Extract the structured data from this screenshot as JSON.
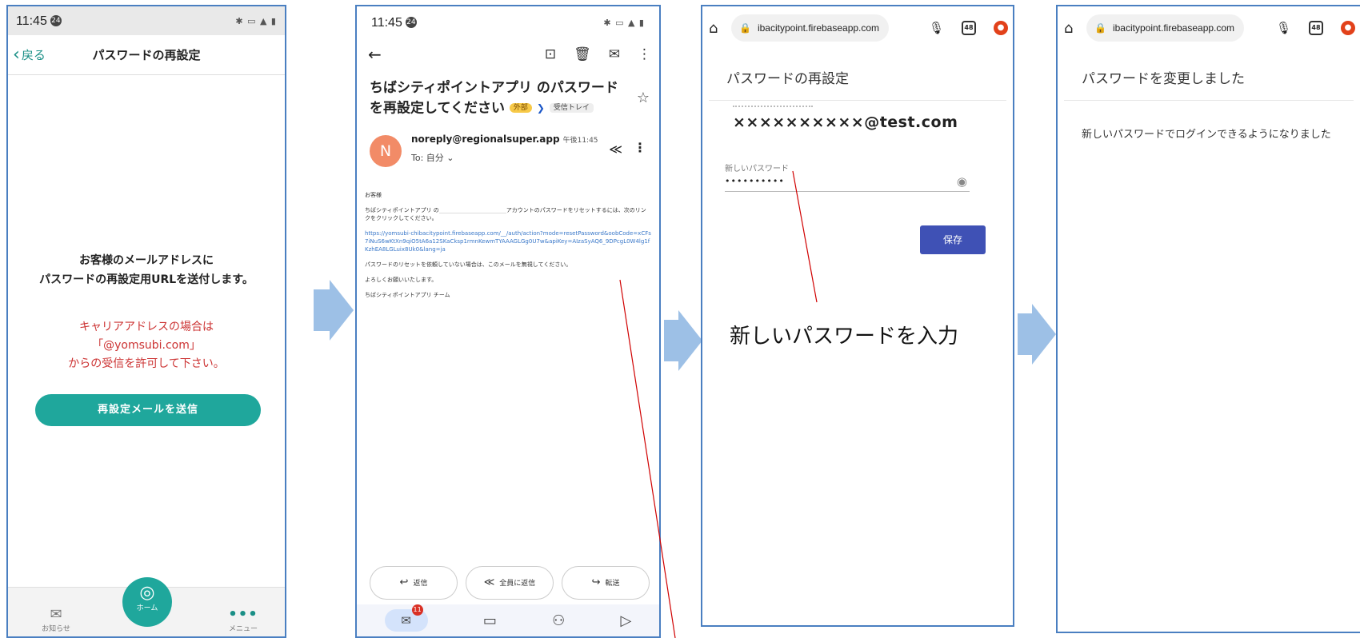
{
  "panel1": {
    "status_time": "11:45",
    "status_badge": "24",
    "back_label": "戻る",
    "title": "パスワードの再設定",
    "message_line1": "お客様のメールアドレスに",
    "message_line2": "パスワードの再設定用URLを送付します。",
    "warn_line1": "キャリアアドレスの場合は",
    "warn_line2": "「@yomsubi.com」",
    "warn_line3": "からの受信を許可して下さい。",
    "send_button": "再設定メールを送信",
    "tab_notice": "お知らせ",
    "tab_home": "ホーム",
    "tab_menu": "メニュー",
    "accent_color": "#1fa79c",
    "warn_color": "#cc3333"
  },
  "panel2": {
    "status_time": "11:45",
    "status_badge": "24",
    "subject": "ちばシティポイントアプリ のパスワードを再設定してください",
    "chip_external": "外部",
    "chip_inbox": "受信トレイ",
    "avatar_letter": "N",
    "sender": "noreply@regionalsuper.app",
    "sent_time": "午後11:45",
    "to_label": "To: 自分",
    "greeting": "お客様",
    "body_line1_a": "ちばシティポイントアプリ の",
    "body_line1_b": "アカウントのパスワードをリセットするには、次のリンクをクリックしてください。",
    "link": "https://yomsubi-chibacitypoint.firebaseapp.com/__/auth/action?mode=resetPassword&oobCode=xCFs7iNuS6wKtXn9qiO5tA6a12SKaCksp1rmnKewmTYAAAGLGg0U7w&apiKey=AIzaSyAQ6_9DPcgL0W4lg1fKzhEA8LGLuix8Uk0&lang=ja",
    "body_ignore": "パスワードのリセットを依頼していない場合は、このメールを無視してください。",
    "body_regards": "よろしくお願いいたします。",
    "body_team": "ちばシティポイントアプリ チーム",
    "reply": "返信",
    "reply_all": "全員に返信",
    "forward": "転送",
    "mail_count": "11"
  },
  "panel3": {
    "url": "ibacitypoint.firebaseapp.com",
    "tab_count": "48",
    "title": "パスワードの再設定",
    "email": "××××××××××@test.com",
    "password_label": "新しいパスワード",
    "password_value": "••••••••••",
    "save_button": "保存",
    "button_color": "#3f51b5"
  },
  "panel4": {
    "url": "ibacitypoint.firebaseapp.com",
    "tab_count": "48",
    "title": "パスワードを変更しました",
    "message": "新しいパスワードでログインできるようになりました"
  },
  "annotation": {
    "text": "新しいパスワードを入力",
    "line_color": "#d00000"
  },
  "arrow_color": "#9dc0e6",
  "frame_color": "#4a7fc1"
}
